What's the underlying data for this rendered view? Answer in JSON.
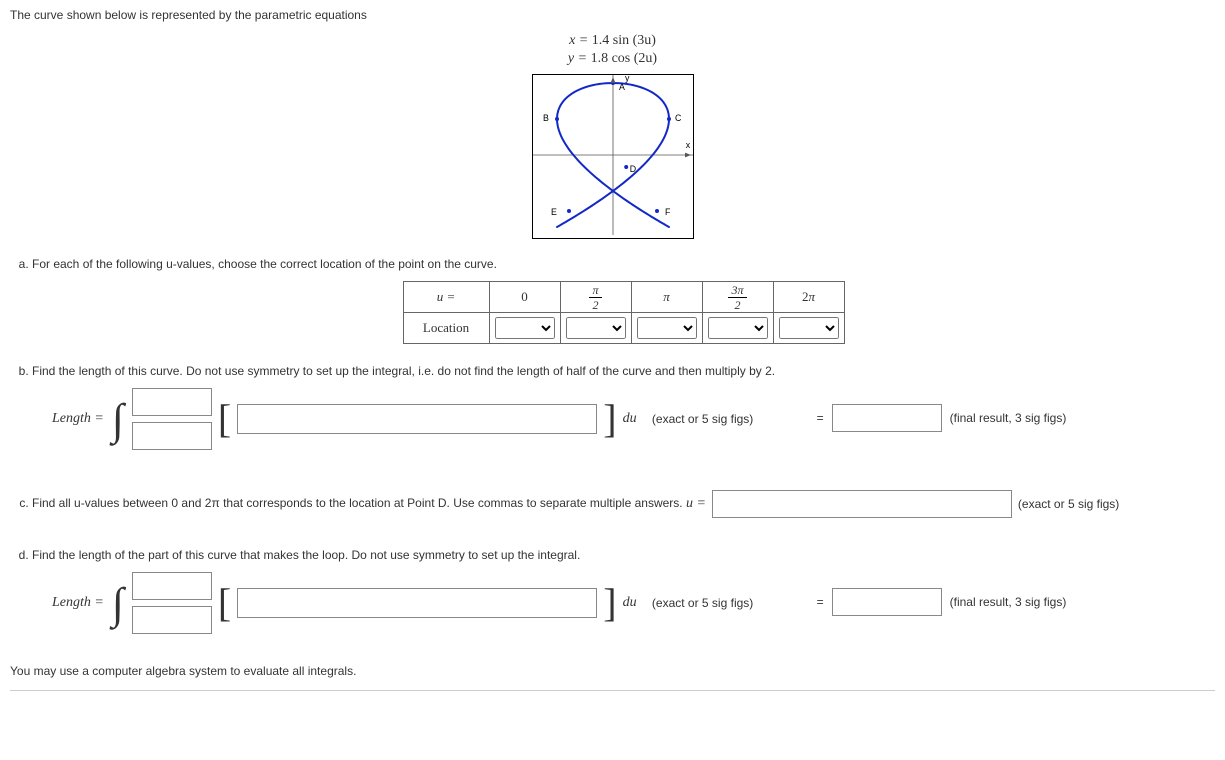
{
  "intro": "The curve shown below is represented by the parametric equations",
  "equations": {
    "line1_lhs": "x = ",
    "line1_rhs": "1.4 sin (3u)",
    "line2_lhs": "y = ",
    "line2_rhs": "1.8 cos (2u)"
  },
  "graph": {
    "axis_x_label": "x",
    "axis_y_label": "y",
    "points": [
      "A",
      "B",
      "C",
      "D",
      "E",
      "F"
    ]
  },
  "part_a": {
    "prompt": "For each of the following u-values, choose the correct location of the point on the curve.",
    "row1_label": "u =",
    "row2_label": "Location",
    "headers": [
      "0",
      "pi_over_2",
      "pi",
      "3pi_over_2",
      "2pi"
    ]
  },
  "part_b": {
    "prompt": "Find the length of this curve. Do not use symmetry to set up the integral, i.e. do not find the length of half of the curve and then multiply by 2.",
    "length_label": "Length =",
    "du_label": "du",
    "integrand_hint": "(exact or 5 sig figs)",
    "equals": "=",
    "result_hint": "(final result, 3 sig figs)"
  },
  "part_c": {
    "prompt": "Find all u-values between 0 and 2π that corresponds to the location at Point D. Use commas to separate multiple answers.",
    "u_label": "u =",
    "hint": "(exact or 5 sig figs)"
  },
  "part_d": {
    "prompt": "Find the length of the part of this curve that makes the loop. Do not use symmetry to set up the integral.",
    "length_label": "Length =",
    "du_label": "du",
    "integrand_hint": "(exact or 5 sig figs)",
    "equals": "=",
    "result_hint": "(final result, 3 sig figs)"
  },
  "footnote": "You may use a computer algebra system to evaluate all integrals.",
  "chart_data": {
    "type": "line",
    "title": "Parametric curve x=1.4 sin(3u), y=1.8 cos(2u)",
    "xlabel": "x",
    "ylabel": "y",
    "xlim": [
      -1.8,
      1.8
    ],
    "ylim": [
      -1.8,
      1.8
    ],
    "parametric": {
      "x_of_u": "1.4*sin(3*u)",
      "y_of_u": "1.8*cos(2*u)",
      "u_range": [
        0,
        6.28319
      ]
    },
    "labeled_points": [
      {
        "name": "A",
        "x": 0.0,
        "y": 1.8
      },
      {
        "name": "B",
        "x": -1.4,
        "y": 0.9
      },
      {
        "name": "C",
        "x": 1.4,
        "y": 0.9
      },
      {
        "name": "D",
        "x": 0.33,
        "y": -0.3
      },
      {
        "name": "E",
        "x": -1.1,
        "y": -1.4
      },
      {
        "name": "F",
        "x": 1.1,
        "y": -1.4
      }
    ]
  }
}
